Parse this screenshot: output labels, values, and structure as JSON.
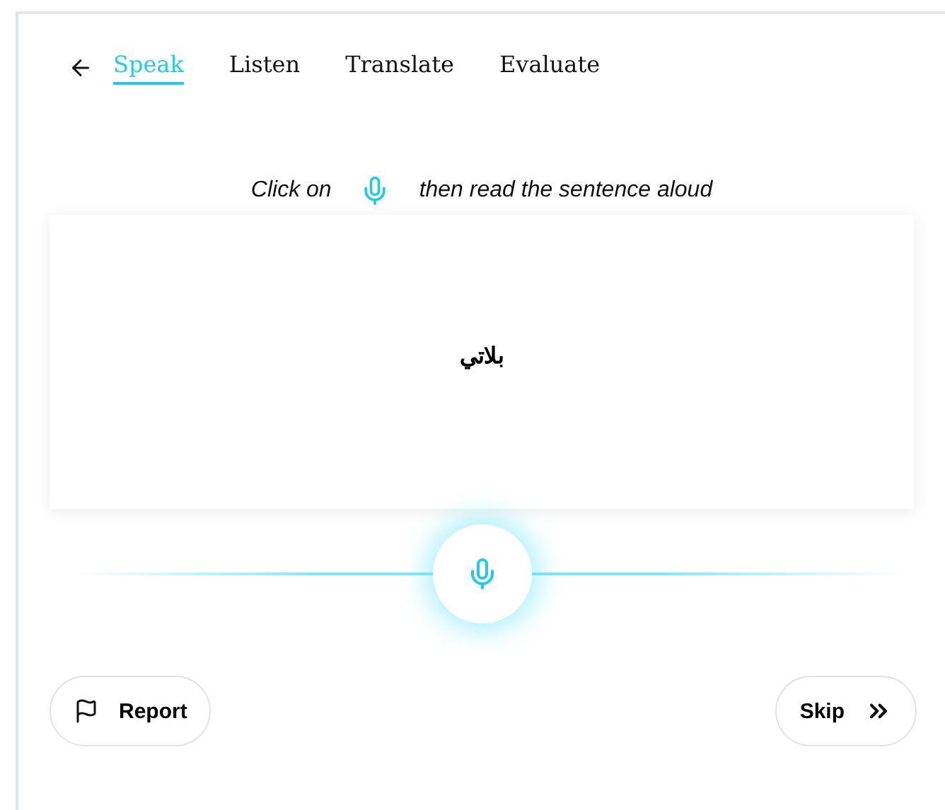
{
  "tabs": [
    {
      "label": "Speak",
      "selected": true
    },
    {
      "label": "Listen",
      "selected": false
    },
    {
      "label": "Translate",
      "selected": false
    },
    {
      "label": "Evaluate",
      "selected": false
    }
  ],
  "instruction": {
    "before": "Click on",
    "after": "then read the sentence aloud"
  },
  "sentence": "بلاتي",
  "buttons": {
    "report": "Report",
    "skip": "Skip"
  }
}
